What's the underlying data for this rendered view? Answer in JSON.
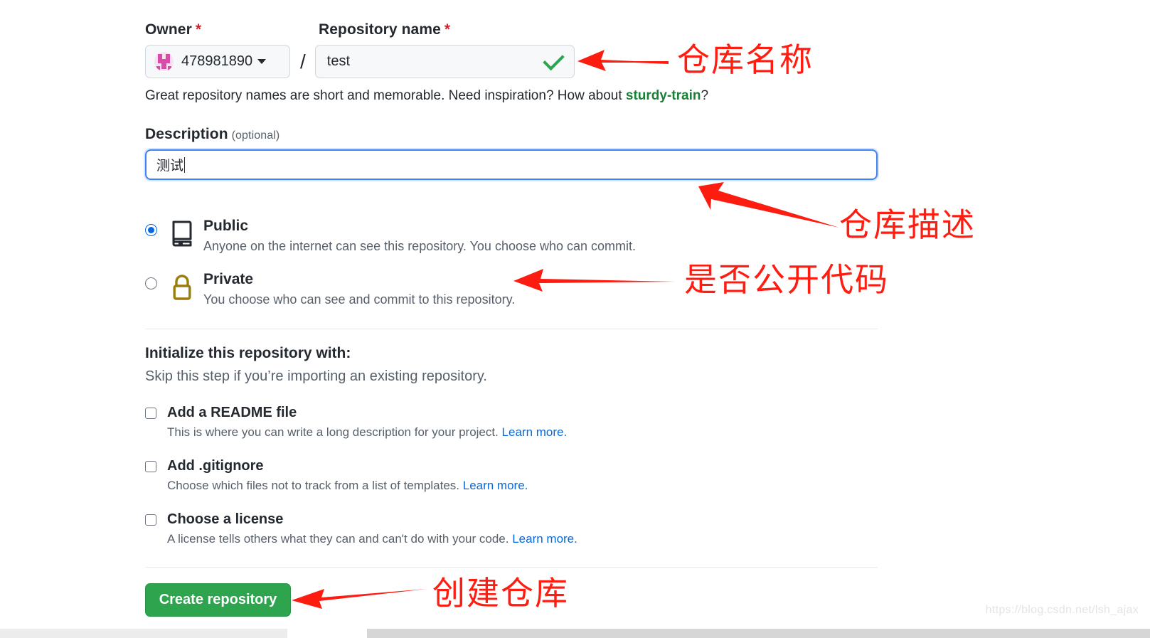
{
  "form": {
    "owner": {
      "label": "Owner",
      "required_mark": "*",
      "name": "478981890",
      "avatar_icon": "user-avatar-identicon",
      "caret_icon": "chevron-down-icon"
    },
    "separator": "/",
    "repo_name": {
      "label": "Repository name",
      "required_mark": "*",
      "value": "test",
      "valid_icon": "check-icon",
      "valid_color": "#2da44e"
    },
    "hint": {
      "text_before": "Great repository names are short and memorable. Need inspiration? How about ",
      "suggestion": "sturdy-train",
      "text_after": "?"
    },
    "description": {
      "label": "Description",
      "optional_note": "(optional)",
      "value": "测试",
      "focused": true,
      "border_color": "#4183f3"
    },
    "visibility": {
      "options": [
        {
          "id": "public",
          "title": "Public",
          "description": "Anyone on the internet can see this repository. You choose who can commit.",
          "icon": "repo-book-icon",
          "icon_color": "#24292f",
          "selected": true
        },
        {
          "id": "private",
          "title": "Private",
          "description": "You choose who can see and commit to this repository.",
          "icon": "lock-icon",
          "icon_color": "#9a7d0a",
          "selected": false
        }
      ]
    },
    "initialize": {
      "title": "Initialize this repository with:",
      "subtitle": "Skip this step if you’re importing an existing repository.",
      "options": [
        {
          "id": "readme",
          "title": "Add a README file",
          "description": "This is where you can write a long description for your project. ",
          "link": "Learn more.",
          "checked": false
        },
        {
          "id": "gitignore",
          "title": "Add .gitignore",
          "description": "Choose which files not to track from a list of templates. ",
          "link": "Learn more.",
          "checked": false
        },
        {
          "id": "license",
          "title": "Choose a license",
          "description": "A license tells others what they can and can't do with your code. ",
          "link": "Learn more.",
          "checked": false
        }
      ]
    },
    "submit": {
      "label": "Create repository",
      "color": "#2ea44f"
    }
  },
  "annotations": {
    "color": "#ff1c10",
    "items": [
      {
        "id": "repo-name",
        "text": "仓库名称"
      },
      {
        "id": "repo-desc",
        "text": "仓库描述"
      },
      {
        "id": "visibility",
        "text": "是否公开代码"
      },
      {
        "id": "create",
        "text": "创建仓库"
      }
    ]
  },
  "watermark": {
    "text": "https://blog.csdn.net/lsh_ajax"
  }
}
